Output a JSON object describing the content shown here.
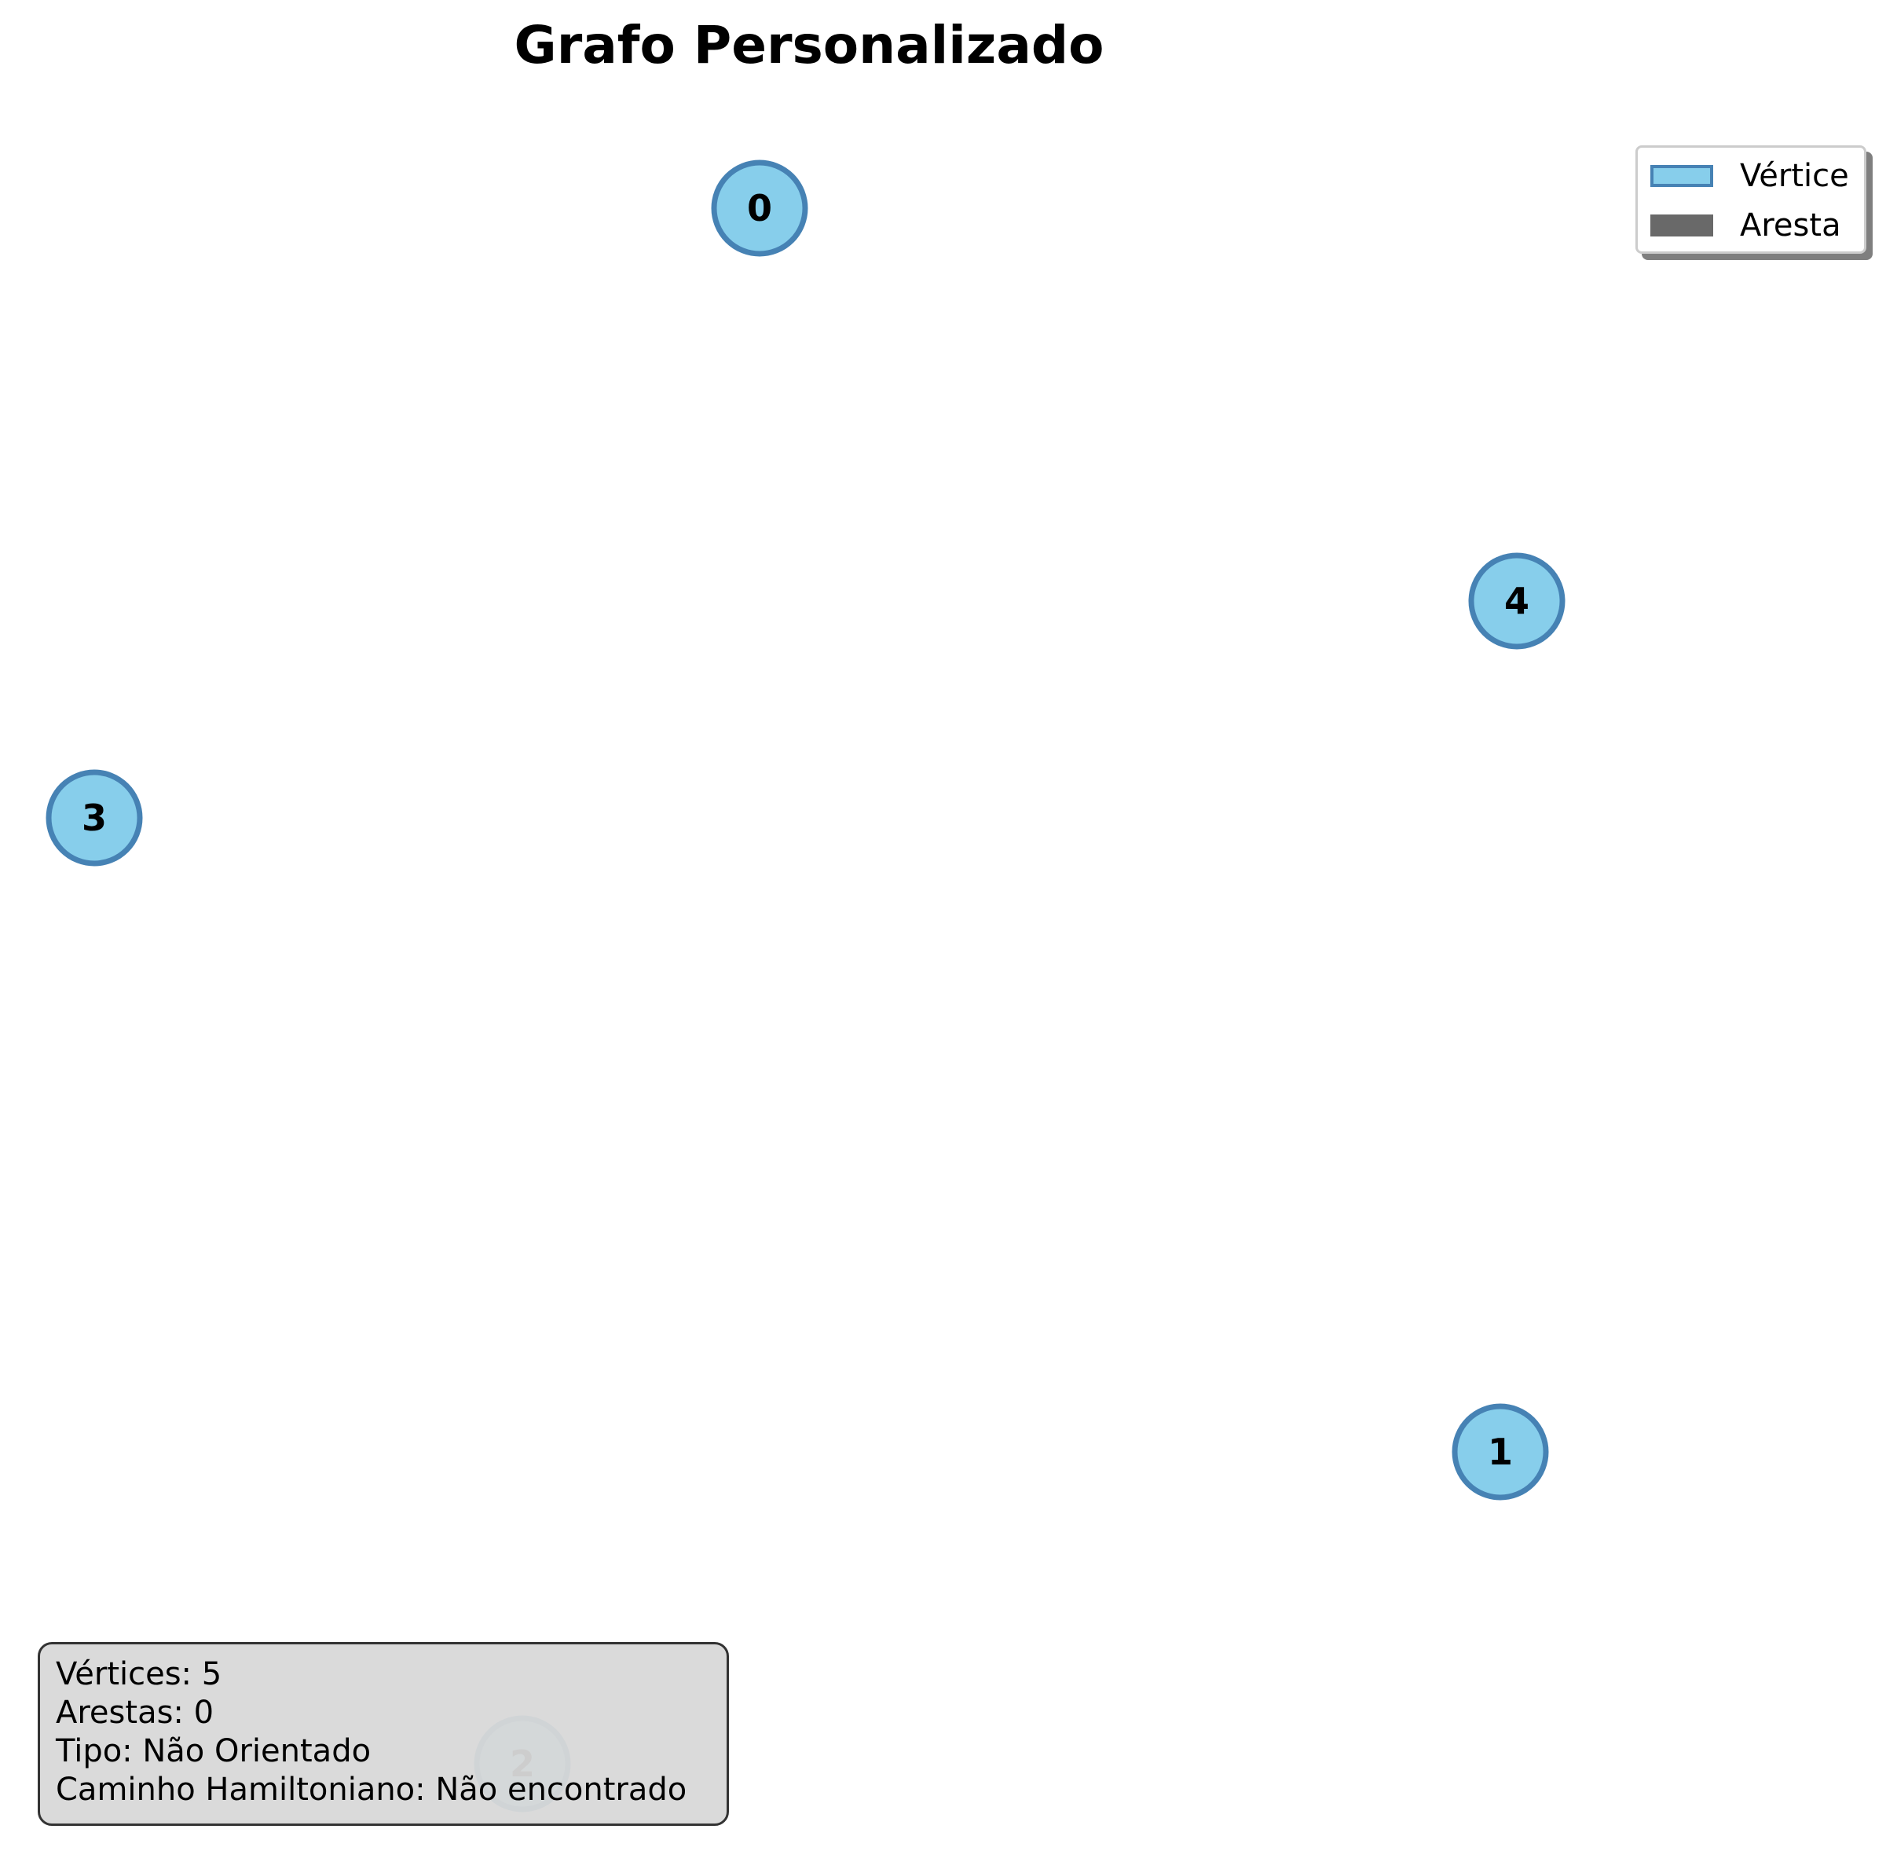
{
  "title": "Grafo Personalizado",
  "colors": {
    "vertex_fill": "#87ceeb",
    "vertex_stroke": "#4682b4",
    "edge": "#696969",
    "info_box_fill": "#d3d3d3",
    "info_box_border": "#333333"
  },
  "graph": {
    "directed": false,
    "vertices": [
      {
        "id": "0",
        "label": "0"
      },
      {
        "id": "1",
        "label": "1"
      },
      {
        "id": "2",
        "label": "2",
        "faded": true
      },
      {
        "id": "3",
        "label": "3"
      },
      {
        "id": "4",
        "label": "4"
      }
    ],
    "edges": []
  },
  "legend": {
    "placement": "top-right",
    "items": [
      {
        "label": "Vértice",
        "kind": "vertex"
      },
      {
        "label": "Aresta",
        "kind": "edge"
      }
    ]
  },
  "info": {
    "placement": "bottom-left",
    "lines": [
      "Vértices: 5",
      "Arestas: 0",
      "Tipo: Não Orientado",
      "Caminho Hamiltoniano: Não encontrado"
    ]
  }
}
